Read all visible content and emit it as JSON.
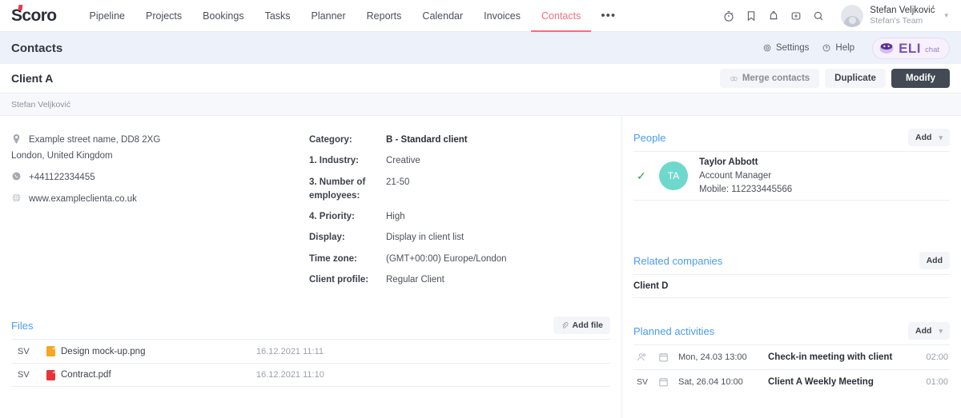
{
  "nav": {
    "logo": "Scoro",
    "links": [
      {
        "label": "Pipeline",
        "active": false
      },
      {
        "label": "Projects",
        "active": false
      },
      {
        "label": "Bookings",
        "active": false
      },
      {
        "label": "Tasks",
        "active": false
      },
      {
        "label": "Planner",
        "active": false
      },
      {
        "label": "Reports",
        "active": false
      },
      {
        "label": "Calendar",
        "active": false
      },
      {
        "label": "Invoices",
        "active": false
      },
      {
        "label": "Contacts",
        "active": true
      }
    ],
    "more": "•••",
    "icons": [
      "timer-icon",
      "bookmark-icon",
      "bell-icon",
      "plus-square-icon",
      "search-icon"
    ],
    "user": {
      "name": "Stefan Veljković",
      "team": "Stefan's Team"
    }
  },
  "subheader": {
    "title": "Contacts",
    "settings": "Settings",
    "help": "Help",
    "eli": {
      "text": "ELI",
      "sub": "chat"
    }
  },
  "titlerow": {
    "title": "Client A",
    "merge": "Merge contacts",
    "duplicate": "Duplicate",
    "modify": "Modify"
  },
  "byline": "Stefan Veljković",
  "contact": {
    "address_line1": "Example street name, DD8 2XG",
    "address_line2": "London, United Kingdom",
    "phone": "+441122334455",
    "website": "www.exampleclienta.co.uk"
  },
  "fields": [
    {
      "label": "Category:",
      "value": "B - Standard client",
      "bold": true
    },
    {
      "label": "1. Industry:",
      "value": "Creative",
      "bold": false
    },
    {
      "label": "3. Number of employees:",
      "value": "21-50",
      "bold": false
    },
    {
      "label": "4. Priority:",
      "value": "High",
      "bold": false
    },
    {
      "label": "Display:",
      "value": "Display in client list",
      "bold": false
    },
    {
      "label": "Time zone:",
      "value": "(GMT+00:00) Europe/London",
      "bold": false
    },
    {
      "label": "Client profile:",
      "value": "Regular Client",
      "bold": false
    }
  ],
  "people": {
    "title": "People",
    "add": "Add",
    "items": [
      {
        "checked": true,
        "initials": "TA",
        "name": "Taylor Abbott",
        "role": "Account Manager",
        "mobile": "Mobile: 112233445566",
        "avatar_color": "#6fd8cd"
      }
    ]
  },
  "files": {
    "title": "Files",
    "add": "Add file",
    "items": [
      {
        "user": "SV",
        "name": "Design mock-up.png",
        "type": "png",
        "date": "16.12.2021 11:11"
      },
      {
        "user": "SV",
        "name": "Contract.pdf",
        "type": "pdf",
        "date": "16.12.2021 11:10"
      }
    ]
  },
  "related_companies": {
    "title": "Related companies",
    "add": "Add",
    "items": [
      {
        "name": "Client D"
      }
    ]
  },
  "planned_activities": {
    "title": "Planned activities",
    "add": "Add",
    "items": [
      {
        "user": "",
        "user_icon": "person-icon",
        "date": "Mon, 24.03 13:00",
        "title": "Check-in meeting with client",
        "duration": "02:00"
      },
      {
        "user": "SV",
        "user_icon": "",
        "date": "Sat, 26.04 10:00",
        "title": "Client A Weekly Meeting",
        "duration": "01:00"
      }
    ]
  }
}
